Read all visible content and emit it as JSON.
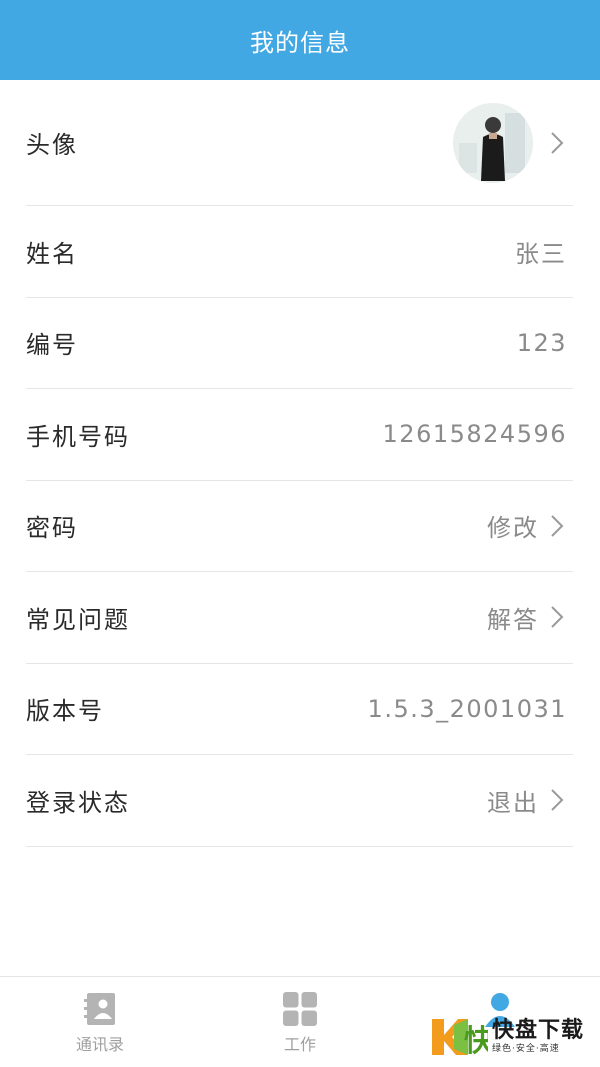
{
  "header": {
    "title": "我的信息"
  },
  "rows": [
    {
      "label": "头像"
    },
    {
      "label": "姓名",
      "value": "张三"
    },
    {
      "label": "编号",
      "value": "123"
    },
    {
      "label": "手机号码",
      "value": "12615824596"
    },
    {
      "label": "密码",
      "value": "修改"
    },
    {
      "label": "常见问题",
      "value": "解答"
    },
    {
      "label": "版本号",
      "value": "1.5.3_2001031"
    },
    {
      "label": "登录状态",
      "value": "退出"
    }
  ],
  "tabbar": {
    "items": [
      {
        "label": "通讯录",
        "icon": "contacts-icon"
      },
      {
        "label": "工作",
        "icon": "grid-icon"
      },
      {
        "label": "",
        "icon": "person-icon"
      }
    ]
  },
  "watermark": {
    "brand": "快盘下载",
    "slogan": "绿色·安全·高速",
    "letter": "K"
  },
  "colors": {
    "accent": "#42a8e4",
    "tab_inactive": "#a0a0a0",
    "value_gray": "#8a8a8a"
  }
}
